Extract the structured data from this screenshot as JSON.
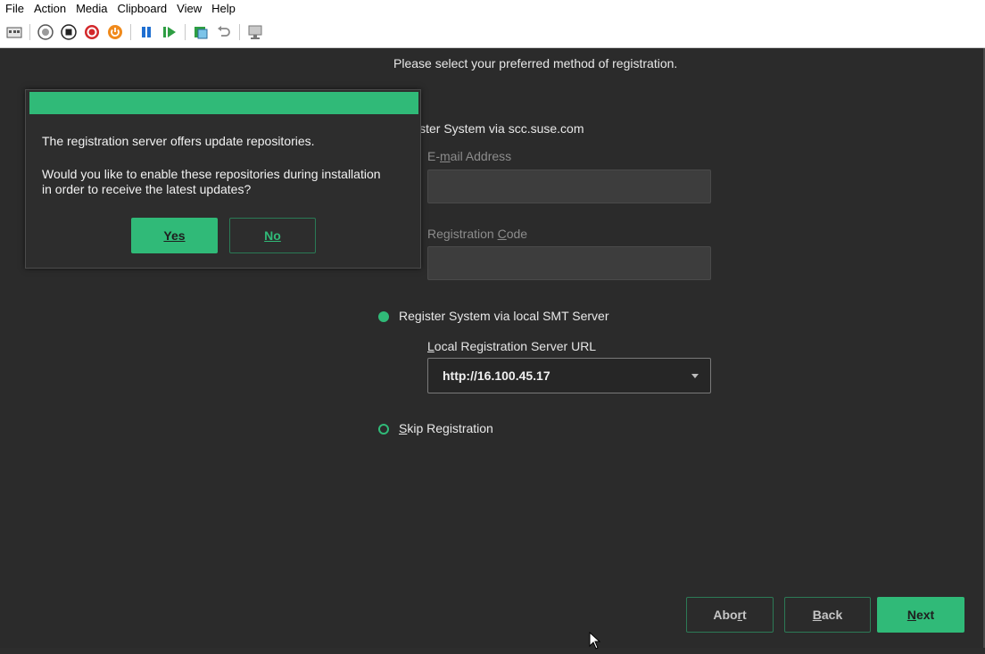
{
  "menu": [
    "File",
    "Action",
    "Media",
    "Clipboard",
    "View",
    "Help"
  ],
  "toolbar": {
    "icons": [
      "ctrl-alt-del-icon",
      "start-icon",
      "turn-off-icon",
      "shutdown-icon",
      "power-reset-icon",
      "pause-icon",
      "resume-icon",
      "checkpoint-icon",
      "revert-icon",
      "enhanced-session-icon"
    ]
  },
  "registration": {
    "heading": "Please select your preferred method of registration.",
    "scc_label": "ister System via scc.suse.com",
    "email_label": "E-mail Address",
    "email_value": "",
    "code_label": "Registration Code",
    "code_value": "",
    "smt_label": "Register System via local SMT Server",
    "server_url_label": "Local Registration Server URL",
    "server_url_value": "http://16.100.45.17",
    "skip_label": "Skip Registration"
  },
  "dialog": {
    "line1": "The registration server offers update repositories.",
    "line2": "Would you like to enable these repositories during installation",
    "line3": "in order to receive the latest updates?",
    "yes_label": "Yes",
    "no_label": "No"
  },
  "footer": {
    "abort_label": "Abort",
    "back_label": "Back",
    "next_label": "Next"
  },
  "colors": {
    "accent": "#30ba78",
    "background": "#2b2b2b"
  }
}
